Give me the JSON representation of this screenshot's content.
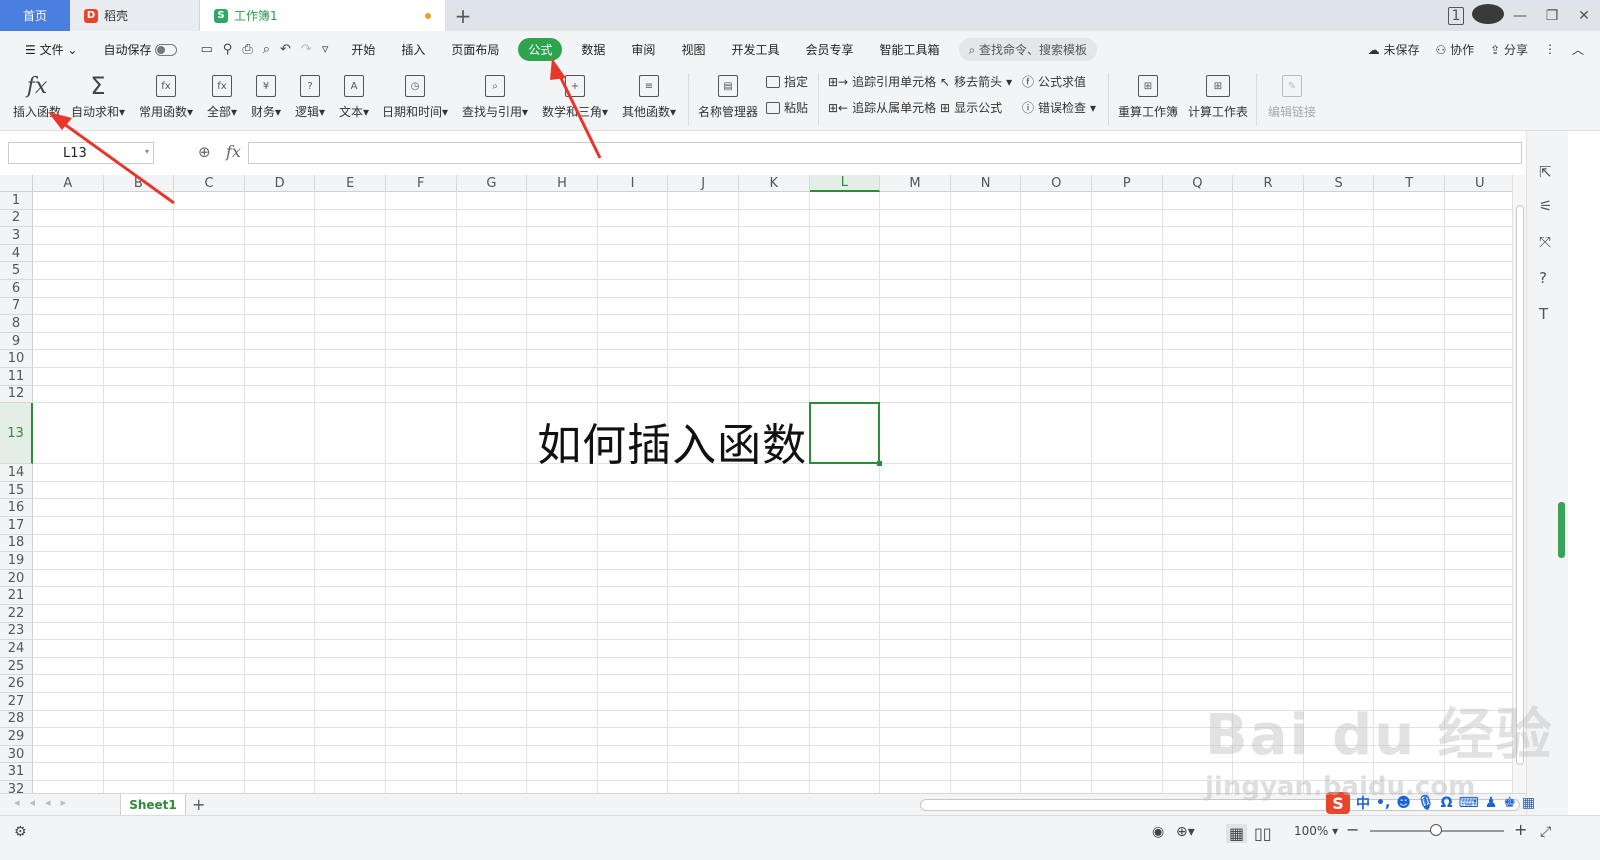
{
  "tabs": {
    "home": "首页",
    "docer": "稻壳",
    "workbook": "工作簿1"
  },
  "window": {
    "page_indicator": "1"
  },
  "menu": {
    "file": "文件",
    "autosave": "自动保存",
    "items": [
      "开始",
      "插入",
      "页面布局",
      "公式",
      "数据",
      "审阅",
      "视图",
      "开发工具",
      "会员专享",
      "智能工具箱"
    ],
    "active_index": 3,
    "search_placeholder": "查找命令、搜索模板",
    "unsaved": "未保存",
    "collab": "协作",
    "share": "分享"
  },
  "ribbon": {
    "insert_function": "插入函数",
    "autosum": "自动求和",
    "common_functions": "常用函数",
    "all": "全部",
    "finance": "财务",
    "logic": "逻辑",
    "text": "文本",
    "datetime": "日期和时间",
    "lookup": "查找与引用",
    "math": "数学和三角",
    "other_functions": "其他函数",
    "name_manager": "名称管理器",
    "assign": "指定",
    "paste": "粘贴",
    "trace_precedents": "追踪引用单元格",
    "trace_dependents": "追踪从属单元格",
    "remove_arrows": "移去箭头",
    "show_formulas": "显示公式",
    "evaluate_formula": "公式求值",
    "error_check": "错误检查",
    "recalc_workbook": "重算工作簿",
    "calc_sheet": "计算工作表",
    "edit_links": "编辑链接"
  },
  "formula_bar": {
    "name_box": "L13",
    "fx": "fx",
    "value": ""
  },
  "sheet": {
    "columns": [
      "A",
      "B",
      "C",
      "D",
      "E",
      "F",
      "G",
      "H",
      "I",
      "J",
      "K",
      "L",
      "M",
      "N",
      "O",
      "P",
      "Q",
      "R",
      "S",
      "T",
      "U"
    ],
    "selected_column": "L",
    "rows": [
      "1",
      "2",
      "3",
      "4",
      "5",
      "6",
      "7",
      "8",
      "9",
      "10",
      "11",
      "12",
      "13",
      "14",
      "15",
      "16",
      "17",
      "18",
      "19",
      "20",
      "21",
      "22",
      "23",
      "24",
      "25",
      "26",
      "27",
      "28",
      "29",
      "30",
      "31",
      "32"
    ],
    "selected_row": "13",
    "cell_text": "如何插入函数",
    "tab_name": "Sheet1"
  },
  "status": {
    "zoom": "100%"
  },
  "watermark": {
    "line1": "Bai du 经验",
    "line2": "jingyan.baidu.com"
  },
  "colors": {
    "accent_green": "#2ea44f",
    "annotation_red": "#e8362a",
    "home_tab": "#4a7fe0"
  }
}
